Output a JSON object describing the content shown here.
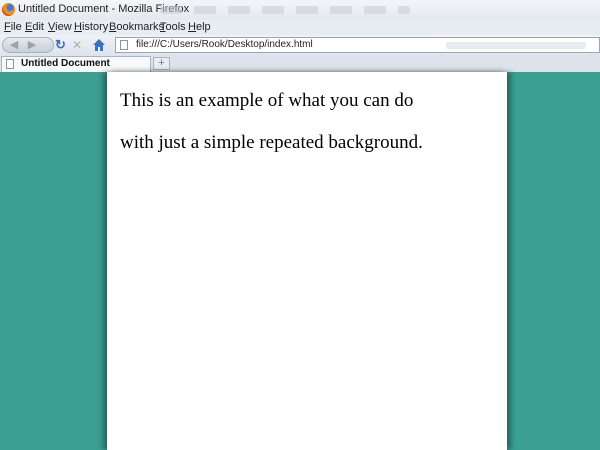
{
  "window": {
    "title": "Untitled Document - Mozilla Firefox",
    "logo_icon": "firefox-logo-icon"
  },
  "menu": {
    "items": [
      "File",
      "Edit",
      "View",
      "History",
      "Bookmarks",
      "Tools",
      "Help"
    ]
  },
  "navigation": {
    "url": "file:///C:/Users/Rook/Desktop/index.html",
    "icons": [
      "back-icon",
      "forward-icon",
      "reload-icon",
      "stop-icon",
      "home-icon",
      "page-icon"
    ]
  },
  "tabs": {
    "items": [
      {
        "label": "Untitled Document"
      }
    ],
    "new_tab_symbol": "+"
  },
  "page": {
    "lines": [
      "This is an example of what you can do",
      "with just a simple repeated background."
    ],
    "colors": {
      "background": "#3b9f92",
      "column": "#ffffff",
      "text": "#000000"
    }
  }
}
